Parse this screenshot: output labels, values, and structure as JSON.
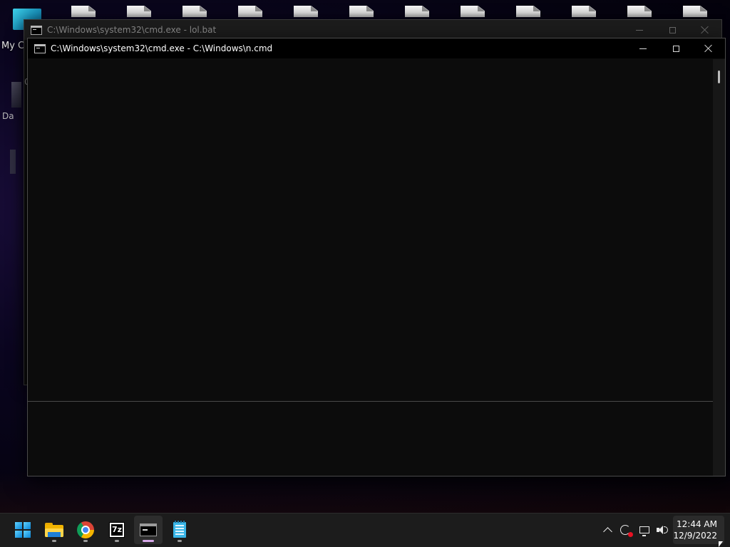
{
  "desktop": {
    "icons": [
      {
        "label": "My C"
      },
      {
        "label": "Da"
      }
    ]
  },
  "back_window": {
    "title": "C:\\Windows\\system32\\cmd.exe - lol.bat",
    "body_text": "C"
  },
  "front_window": {
    "title": "C:\\Windows\\system32\\cmd.exe - C:\\Windows\\n.cmd"
  },
  "taskbar": {
    "apps": [
      {
        "name": "start",
        "icon": "windows-start-icon"
      },
      {
        "name": "file-explorer",
        "icon": "folder-icon"
      },
      {
        "name": "chrome",
        "icon": "chrome-icon"
      },
      {
        "name": "7zip",
        "icon": "7zip-icon",
        "label": "7z"
      },
      {
        "name": "command-prompt",
        "icon": "terminal-icon",
        "active": true
      },
      {
        "name": "notepad",
        "icon": "notepad-icon"
      }
    ],
    "tray": {
      "icons": [
        "chevron-up-icon",
        "sync-icon",
        "network-icon",
        "volume-icon"
      ]
    },
    "clock": {
      "time": "12:44 AM",
      "date": "12/9/2022"
    }
  },
  "colors": {
    "console_bg": "#0c0c0c",
    "titlebar_active": "#000000",
    "taskbar_bg": "#1c1c1c",
    "active_indicator": "#d6a8e8"
  }
}
